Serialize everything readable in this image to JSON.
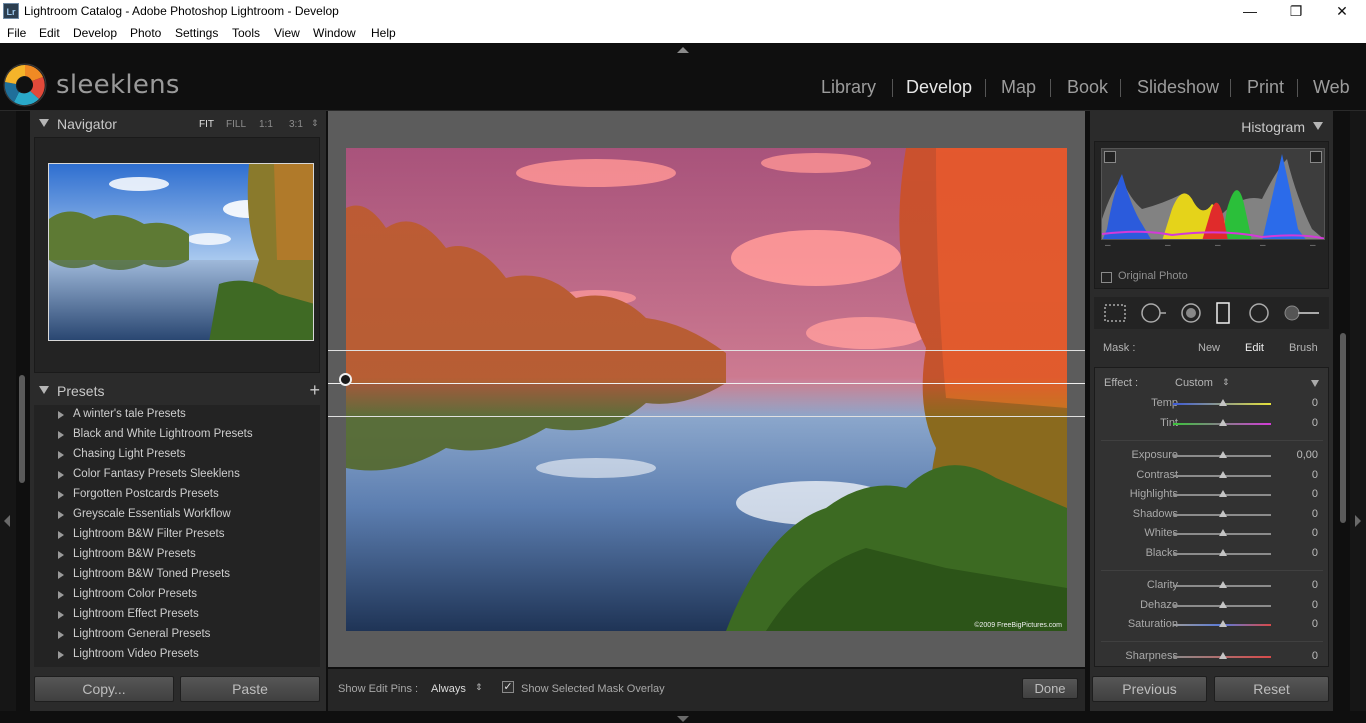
{
  "window": {
    "title": "Lightroom Catalog - Adobe Photoshop Lightroom - Develop",
    "app_icon": "Lr",
    "controls": [
      "minimize-icon",
      "restore-icon",
      "close-icon"
    ]
  },
  "menu": [
    "File",
    "Edit",
    "Develop",
    "Photo",
    "Settings",
    "Tools",
    "View",
    "Window",
    "Help"
  ],
  "logo": {
    "text": "sleeklens"
  },
  "modules": [
    {
      "label": "Library",
      "active": false
    },
    {
      "label": "Develop",
      "active": true
    },
    {
      "label": "Map",
      "active": false
    },
    {
      "label": "Book",
      "active": false
    },
    {
      "label": "Slideshow",
      "active": false
    },
    {
      "label": "Print",
      "active": false
    },
    {
      "label": "Web",
      "active": false
    }
  ],
  "navigator": {
    "title": "Navigator",
    "options": [
      {
        "label": "FIT",
        "active": true
      },
      {
        "label": "FILL",
        "active": false
      },
      {
        "label": "1:1",
        "active": false
      },
      {
        "label": "3:1",
        "active": false
      }
    ]
  },
  "presets": {
    "title": "Presets",
    "add_label": "+",
    "items": [
      "A winter's tale Presets",
      "Black and White Lightroom Presets",
      "Chasing Light Presets",
      "Color Fantasy Presets Sleeklens",
      "Forgotten Postcards Presets",
      "Greyscale Essentials Workflow",
      "Lightroom B&W Filter Presets",
      "Lightroom B&W Presets",
      "Lightroom B&W Toned Presets",
      "Lightroom Color Presets",
      "Lightroom Effect Presets",
      "Lightroom General Presets",
      "Lightroom Video Presets"
    ]
  },
  "left_buttons": {
    "copy": "Copy...",
    "paste": "Paste"
  },
  "photo": {
    "watermark": "©2009 FreeBigPictures.com"
  },
  "toolbar": {
    "show_pins_label": "Show Edit Pins :",
    "show_pins_value": "Always",
    "overlay_label": "Show Selected Mask Overlay",
    "overlay_checked": true,
    "done": "Done"
  },
  "histogram": {
    "title": "Histogram",
    "original_photo": "Original Photo",
    "readouts": [
      "–",
      "–",
      "–",
      "–",
      "–"
    ]
  },
  "tools": [
    "crop-overlay-icon",
    "spot-removal-icon",
    "red-eye-icon",
    "graduated-filter-icon",
    "radial-filter-icon",
    "adjustment-brush-icon"
  ],
  "mask": {
    "label": "Mask :",
    "new": "New",
    "edit": "Edit",
    "brush": "Brush",
    "active": "Edit"
  },
  "effect": {
    "label": "Effect :",
    "value": "Custom"
  },
  "sliders": [
    {
      "label": "Temp",
      "value": "0",
      "group": 1,
      "track": "temp"
    },
    {
      "label": "Tint",
      "value": "0",
      "group": 1,
      "track": "tint"
    },
    {
      "label": "Exposure",
      "value": "0,00",
      "group": 2,
      "track": "grey"
    },
    {
      "label": "Contrast",
      "value": "0",
      "group": 2,
      "track": "grey"
    },
    {
      "label": "Highlights",
      "value": "0",
      "group": 2,
      "track": "grey"
    },
    {
      "label": "Shadows",
      "value": "0",
      "group": 2,
      "track": "grey"
    },
    {
      "label": "Whites",
      "value": "0",
      "group": 2,
      "track": "grey"
    },
    {
      "label": "Blacks",
      "value": "0",
      "group": 2,
      "track": "grey"
    },
    {
      "label": "Clarity",
      "value": "0",
      "group": 3,
      "track": "grey"
    },
    {
      "label": "Dehaze",
      "value": "0",
      "group": 3,
      "track": "grey"
    },
    {
      "label": "Saturation",
      "value": "0",
      "group": 3,
      "track": "sat"
    },
    {
      "label": "Sharpness",
      "value": "0",
      "group": 4,
      "track": "sharp"
    }
  ],
  "right_buttons": {
    "previous": "Previous",
    "reset": "Reset"
  },
  "colors": {
    "panel": "#2b2b2b",
    "center_bg": "#5c5c5c",
    "mask_overlay": "#ff3c3c",
    "text_active": "#e6e6e6"
  }
}
